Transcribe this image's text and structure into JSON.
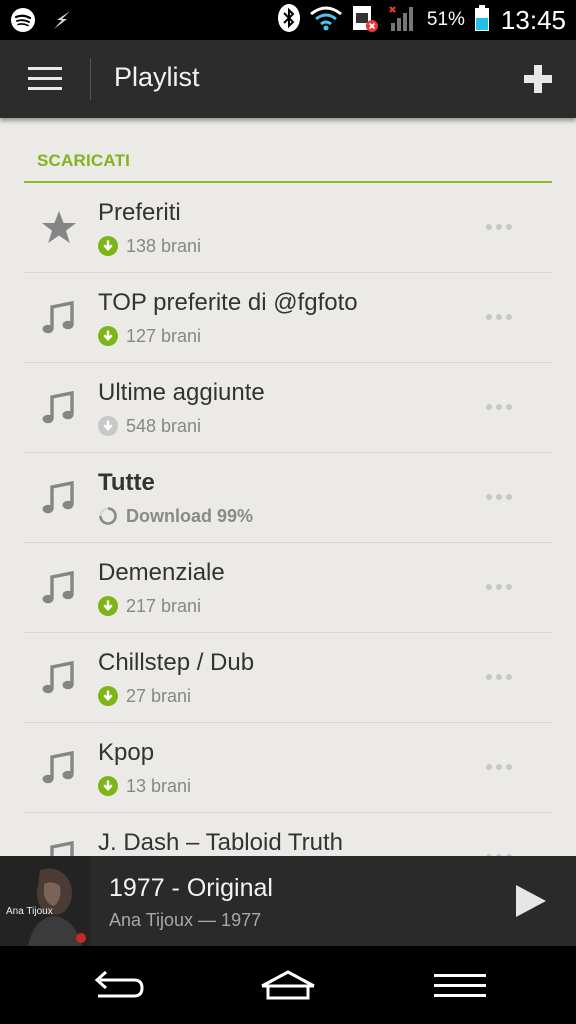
{
  "status_bar": {
    "icons": [
      "spotify-icon",
      "flash-icon",
      "bluetooth-icon",
      "wifi-icon",
      "sim-card-icon",
      "signal-icon",
      "battery-icon"
    ],
    "battery_percent": "51%",
    "time": "13:45"
  },
  "action_bar": {
    "title": "Playlist",
    "menu_icon": "hamburger-menu-icon",
    "add_icon": "plus-icon"
  },
  "section": {
    "title": "SCARICATI"
  },
  "playlists": [
    {
      "title": "Preferiti",
      "subtitle": "138 brani",
      "icon": "star-icon",
      "status": "downloaded"
    },
    {
      "title": "TOP preferite di @fgfoto",
      "subtitle": "127 brani",
      "icon": "music-note-icon",
      "status": "downloaded"
    },
    {
      "title": "Ultime aggiunte",
      "subtitle": "548 brani",
      "icon": "music-note-icon",
      "status": "pending"
    },
    {
      "title": "Tutte",
      "subtitle": "Download 99%",
      "icon": "music-note-icon",
      "status": "downloading"
    },
    {
      "title": "Demenziale",
      "subtitle": "217 brani",
      "icon": "music-note-icon",
      "status": "downloaded"
    },
    {
      "title": "Chillstep / Dub",
      "subtitle": "27 brani",
      "icon": "music-note-icon",
      "status": "downloaded"
    },
    {
      "title": "Kpop",
      "subtitle": "13 brani",
      "icon": "music-note-icon",
      "status": "downloaded"
    },
    {
      "title": "J. Dash – Tabloid Truth",
      "subtitle": "",
      "icon": "music-note-icon",
      "status": "downloaded"
    }
  ],
  "now_playing": {
    "title": "1977 - Original",
    "subtitle": "Ana Tijoux — 1977",
    "album_art_text": "Ana Tijoux"
  },
  "colors": {
    "accent_green": "#82b31e",
    "action_bar": "#2c2c2c",
    "background": "#ebeae6",
    "now_playing": "#2a2a2a"
  }
}
